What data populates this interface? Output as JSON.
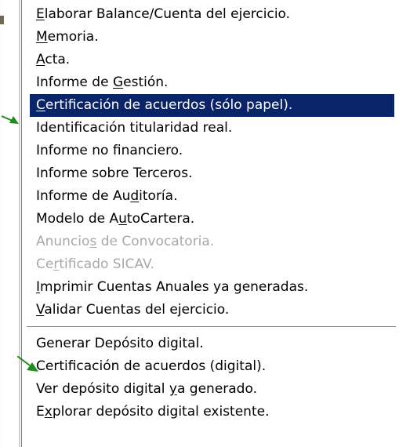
{
  "menu": {
    "items": [
      {
        "pre": "",
        "key": "E",
        "post": "laborar Balance/Cuenta del ejercicio.",
        "state": "normal"
      },
      {
        "pre": "",
        "key": "M",
        "post": "emoria.",
        "state": "normal"
      },
      {
        "pre": "",
        "key": "A",
        "post": "cta.",
        "state": "normal"
      },
      {
        "pre": "Informe de ",
        "key": "G",
        "post": "estión.",
        "state": "normal"
      },
      {
        "pre": "",
        "key": "C",
        "post": "ertificación de acuerdos (sólo papel).",
        "state": "selected"
      },
      {
        "pre": "Identificación titularidad real.",
        "key": "",
        "post": "",
        "state": "normal"
      },
      {
        "pre": "Informe no financiero.",
        "key": "",
        "post": "",
        "state": "normal"
      },
      {
        "pre": "Informe sobre Terceros.",
        "key": "",
        "post": "",
        "state": "normal"
      },
      {
        "pre": "Informe de Au",
        "key": "d",
        "post": "itoría.",
        "state": "normal"
      },
      {
        "pre": "Modelo de A",
        "key": "u",
        "post": "toCartera.",
        "state": "normal"
      },
      {
        "pre": "Anuncio",
        "key": "s",
        "post": " de Convocatoria.",
        "state": "disabled"
      },
      {
        "pre": "Ce",
        "key": "r",
        "post": "tificado SICAV.",
        "state": "disabled"
      },
      {
        "pre": "",
        "key": "I",
        "post": "mprimir Cuentas Anuales ya generadas.",
        "state": "normal"
      },
      {
        "pre": "",
        "key": "V",
        "post": "alidar Cuentas del ejercicio.",
        "state": "normal"
      }
    ],
    "items_after_separator": [
      {
        "pre": "Generar Depósito digital.",
        "key": "",
        "post": "",
        "state": "normal"
      },
      {
        "pre": "Certificación de acuerdos (digital).",
        "key": "",
        "post": "",
        "state": "normal"
      },
      {
        "pre": "Ver depósito digital ",
        "key": "y",
        "post": "a generado.",
        "state": "normal"
      },
      {
        "pre": "E",
        "key": "x",
        "post": "plorar depósito digital existente.",
        "state": "normal"
      }
    ]
  },
  "colors": {
    "selection_bg": "#0a246a",
    "selection_fg": "#ffffff",
    "disabled_fg": "#a8a8a8",
    "arrow": "#1e8c1e"
  },
  "icons": {
    "pointer_arrow": "green-arrow-icon"
  }
}
